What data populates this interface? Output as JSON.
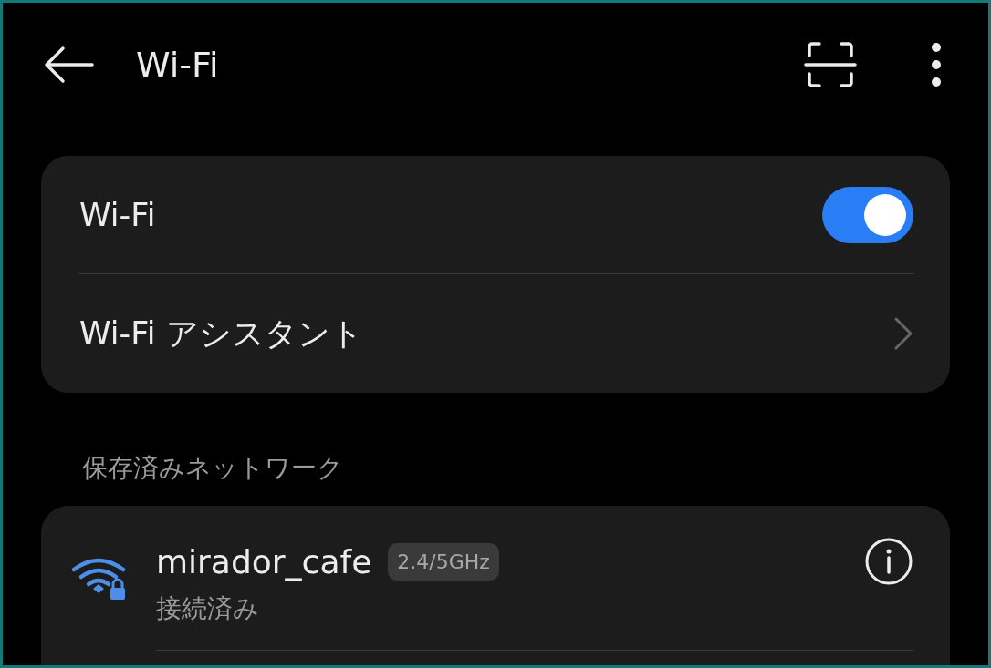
{
  "header": {
    "title": "Wi-Fi"
  },
  "settings": [
    {
      "kind": "toggle",
      "label": "Wi-Fi",
      "on": true
    },
    {
      "kind": "link",
      "label": "Wi-Fi アシスタント"
    }
  ],
  "saved_section": {
    "heading": "保存済みネットワーク",
    "networks": [
      {
        "name": "mirador_cafe",
        "band": "2.4/5GHz",
        "status": "接続済み",
        "locked": true,
        "connected": true
      }
    ]
  }
}
